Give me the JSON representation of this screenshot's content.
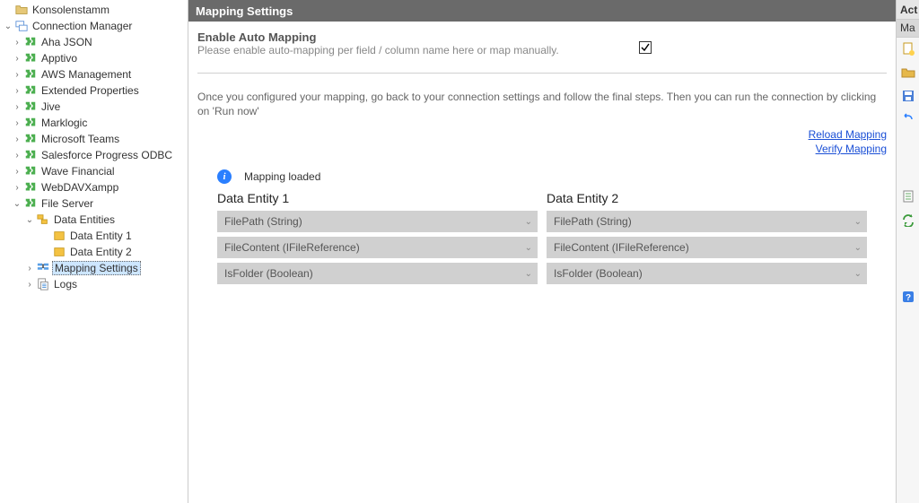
{
  "tree": {
    "root_label": "Konsolenstamm",
    "conn_mgr_label": "Connection Manager",
    "connections": [
      {
        "label": "Aha JSON"
      },
      {
        "label": "Apptivo"
      },
      {
        "label": "AWS Management"
      },
      {
        "label": "Extended Properties"
      },
      {
        "label": "Jive"
      },
      {
        "label": "Marklogic"
      },
      {
        "label": "Microsoft Teams"
      },
      {
        "label": "Salesforce Progress ODBC"
      },
      {
        "label": "Wave Financial"
      },
      {
        "label": "WebDAVXampp"
      }
    ],
    "file_server_label": "File Server",
    "data_entities_label": "Data Entities",
    "entity1_label": "Data Entity 1",
    "entity2_label": "Data Entity 2",
    "mapping_settings_label": "Mapping Settings",
    "logs_label": "Logs"
  },
  "main": {
    "title": "Mapping Settings",
    "enable_title": "Enable Auto Mapping",
    "enable_sub": "Please enable auto-mapping per field / column name here or map manually.",
    "instructions": "Once you configured your mapping, go back to your connection settings and follow the final steps. Then you can run the connection by clicking on 'Run now'",
    "reload_link": "Reload Mapping",
    "verify_link": "Verify Mapping",
    "status_text": "Mapping loaded",
    "col1_title": "Data Entity 1",
    "col2_title": "Data Entity 2",
    "fields1": [
      "FilePath (String)",
      "FileContent (IFileReference)",
      "IsFolder (Boolean)"
    ],
    "fields2": [
      "FilePath (String)",
      "FileContent (IFileReference)",
      "IsFolder (Boolean)"
    ]
  },
  "right": {
    "header": "Act",
    "tab": "Ma"
  }
}
